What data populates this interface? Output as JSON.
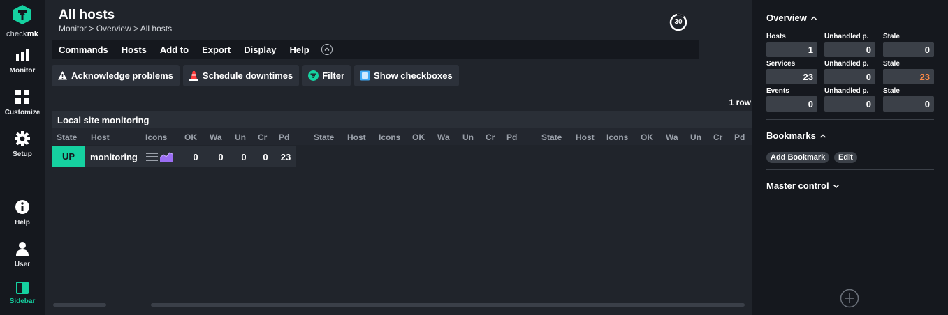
{
  "brand": {
    "name_light": "check",
    "name_bold": "mk",
    "accent": "#15d1a0"
  },
  "left_nav": {
    "items": [
      {
        "label": "Monitor",
        "icon": "bar-chart-icon"
      },
      {
        "label": "Customize",
        "icon": "grid-icon"
      },
      {
        "label": "Setup",
        "icon": "gear-icon"
      },
      {
        "label": "Help",
        "icon": "info-icon"
      },
      {
        "label": "User",
        "icon": "user-icon"
      },
      {
        "label": "Sidebar",
        "icon": "sidebar-icon"
      }
    ]
  },
  "header": {
    "title": "All hosts",
    "breadcrumb": [
      "Monitor",
      "Overview",
      "All hosts"
    ],
    "breadcrumb_sep": ">",
    "reload_seconds": "30"
  },
  "menu": {
    "items": [
      "Commands",
      "Hosts",
      "Add to",
      "Export",
      "Display",
      "Help"
    ]
  },
  "actions": {
    "acknowledge": "Acknowledge problems",
    "downtimes": "Schedule downtimes",
    "filter": "Filter",
    "checkboxes": "Show checkboxes"
  },
  "table": {
    "row_count": "1 row",
    "group_title": "Local site monitoring",
    "columns": [
      "State",
      "Host",
      "Icons",
      "OK",
      "Wa",
      "Un",
      "Cr",
      "Pd"
    ],
    "rows": [
      {
        "state": "UP",
        "host": "monitoring",
        "ok": "0",
        "wa": "0",
        "un": "0",
        "cr": "0",
        "pd": "23"
      }
    ]
  },
  "sidebar": {
    "overview": {
      "title": "Overview",
      "rows": [
        {
          "label": "Hosts",
          "value": "1",
          "unhandled_label": "Unhandled p.",
          "unhandled": "0",
          "stale_label": "Stale",
          "stale": "0"
        },
        {
          "label": "Services",
          "value": "23",
          "unhandled_label": "Unhandled p.",
          "unhandled": "0",
          "stale_label": "Stale",
          "stale": "23"
        },
        {
          "label": "Events",
          "value": "0",
          "unhandled_label": "Unhandled p.",
          "unhandled": "0",
          "stale_label": "Stale",
          "stale": "0"
        }
      ]
    },
    "bookmarks": {
      "title": "Bookmarks",
      "add_label": "Add Bookmark",
      "edit_label": "Edit"
    },
    "master_control": {
      "title": "Master control"
    }
  },
  "colors": {
    "up": "#15d1a0",
    "warn": "#ff8a46",
    "bg": "#20242b",
    "panel": "#15181e"
  }
}
